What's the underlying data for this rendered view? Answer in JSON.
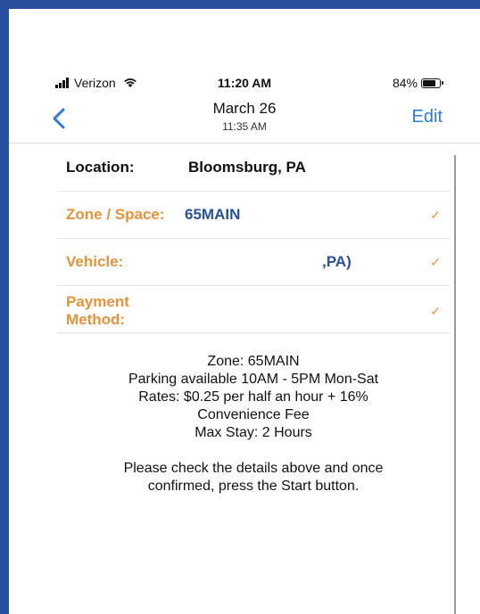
{
  "status": {
    "carrier": "Verizon",
    "time": "11:20 AM",
    "battery": "84%",
    "battery_level": 0.84
  },
  "nav": {
    "title": "March 26",
    "subtitle": "11:35 AM",
    "edit_label": "Edit"
  },
  "rows": {
    "location": {
      "label": "Location:",
      "value": "Bloomsburg, PA"
    },
    "zone": {
      "label": "Zone / Space:",
      "value": "65MAIN"
    },
    "vehicle": {
      "label": "Vehicle:",
      "value": ",PA)"
    },
    "payment": {
      "label_line1": "Payment",
      "label_line2": "Method:"
    }
  },
  "info": {
    "zone": "Zone: 65MAIN",
    "availability": "Parking available 10AM - 5PM Mon-Sat",
    "rates": "Rates: $0.25 per half an hour + 16%",
    "fee": "Convenience Fee",
    "max_stay": "Max Stay: 2 Hours",
    "instructions_1": "Please check the details above and once",
    "instructions_2": "confirmed, press the Start button."
  },
  "colors": {
    "accent_orange": "#e8923a",
    "value_blue": "#27529d",
    "link_blue": "#2d7bd9",
    "frame_blue": "#2a4f9c"
  },
  "icons": {
    "check": "✓",
    "back": "chevron-left"
  }
}
